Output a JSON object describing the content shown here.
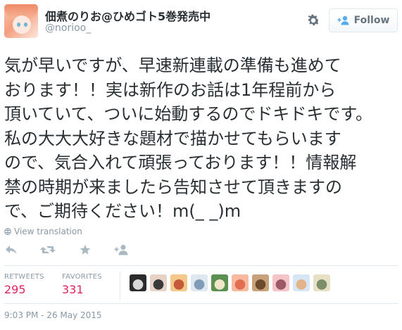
{
  "user": {
    "display_name": "佃煮のりお@ひめゴト5巻発売中",
    "handle": "@norioo_"
  },
  "header": {
    "follow_label": "Follow",
    "gear_icon": "gear-icon",
    "follow_icon": "add-user-icon"
  },
  "tweet": {
    "lines": [
      "気が早いですが、早速新連載の準備も進めて",
      "おります！！実は新作のお話は1年程前から",
      "頂いていて、ついに始動するのでドキドキです。",
      "私の大大大好きな題材で描かせてもらいます",
      "ので、気合入れて頑張っております！！情報解",
      "禁の時期が来ましたら告知させて頂きますの",
      "で、ご期待ください！m(_ _)m"
    ]
  },
  "translate": {
    "label": "View translation",
    "icon": "globe-icon"
  },
  "actions": [
    {
      "name": "reply-icon"
    },
    {
      "name": "retweet-icon"
    },
    {
      "name": "favorite-icon"
    },
    {
      "name": "follow-icon"
    }
  ],
  "stats": {
    "retweets_label": "RETWEETS",
    "retweets_count": "295",
    "favorites_label": "FAVORITES",
    "favorites_count": "331"
  },
  "favoriters": [
    {
      "name": "favoriter-avatar",
      "colors": [
        "#2b2b2b",
        "#d9d9d9"
      ]
    },
    {
      "name": "favoriter-avatar",
      "colors": [
        "#e7d3c6",
        "#3a3a3a"
      ]
    },
    {
      "name": "favoriter-avatar",
      "colors": [
        "#f4c88a",
        "#c45a3a"
      ]
    },
    {
      "name": "favoriter-avatar",
      "colors": [
        "#dfe7ef",
        "#7f9bb7"
      ]
    },
    {
      "name": "favoriter-avatar",
      "colors": [
        "#5c8f52",
        "#f0e6c8"
      ]
    },
    {
      "name": "favoriter-avatar",
      "colors": [
        "#f7b9a0",
        "#e06e4f"
      ]
    },
    {
      "name": "favoriter-avatar",
      "colors": [
        "#c7a27a",
        "#6b4a2e"
      ]
    },
    {
      "name": "favoriter-avatar",
      "colors": [
        "#f3c4c8",
        "#9b5a66"
      ]
    },
    {
      "name": "favoriter-avatar",
      "colors": [
        "#d7e6f4",
        "#e3b38a"
      ]
    },
    {
      "name": "favoriter-avatar",
      "colors": [
        "#e8e0c4",
        "#7a8f6a"
      ]
    }
  ],
  "timestamp": "9:03 PM - 26 May 2015",
  "colors": {
    "text": "#292f33",
    "muted": "#8899a6",
    "accent_blue": "#55acee",
    "count_red": "#e0245e",
    "border": "#e1e8ed"
  }
}
